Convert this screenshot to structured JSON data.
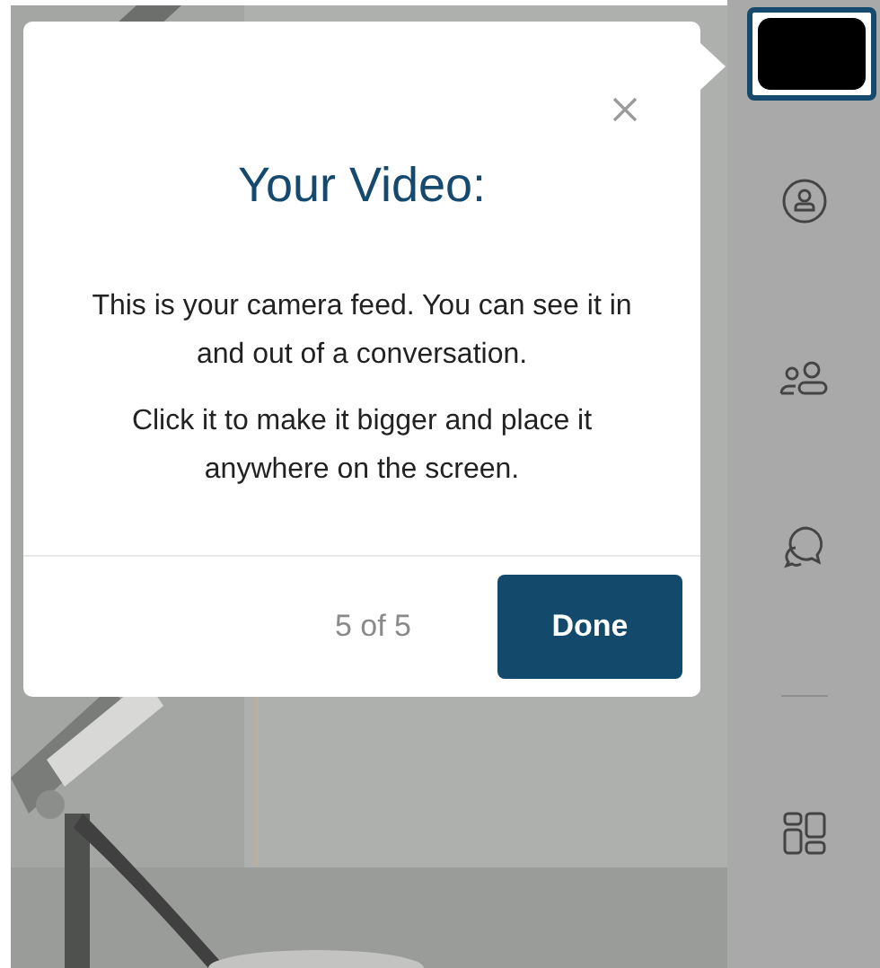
{
  "tour_popover": {
    "title": "Your Video:",
    "paragraphs": [
      "This is your camera feed. You can see it in and out of a conversation.",
      "Click it to make it bigger and place it anywhere on the screen."
    ],
    "step": "5 of 5",
    "button": "Done"
  }
}
